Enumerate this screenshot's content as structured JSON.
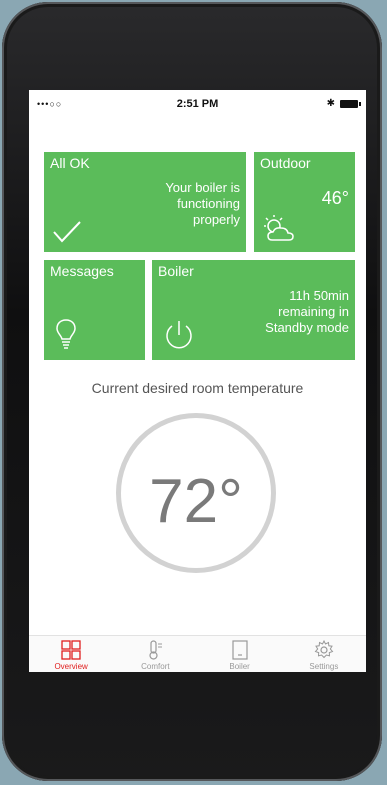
{
  "status": {
    "signal": "•••○○",
    "time": "2:51 PM"
  },
  "tiles": {
    "ok": {
      "title": "All OK",
      "lines": [
        "Your boiler is",
        "functioning",
        "properly"
      ]
    },
    "outdoor": {
      "title": "Outdoor",
      "temperature": "46°"
    },
    "messages": {
      "title": "Messages"
    },
    "boiler": {
      "title": "Boiler",
      "lines": [
        "11h 50min",
        "remaining in",
        "Standby mode"
      ]
    }
  },
  "desired": {
    "label": "Current desired room temperature",
    "value": "72°"
  },
  "tabs": [
    {
      "label": "Overview",
      "icon": "grid-icon",
      "active": true
    },
    {
      "label": "Comfort",
      "icon": "thermometer-icon",
      "active": false
    },
    {
      "label": "Boiler",
      "icon": "boiler-icon",
      "active": false
    },
    {
      "label": "Settings",
      "icon": "gear-icon",
      "active": false
    }
  ],
  "colors": {
    "tile_green": "#5bbc5a",
    "active_tab": "#e02020"
  }
}
